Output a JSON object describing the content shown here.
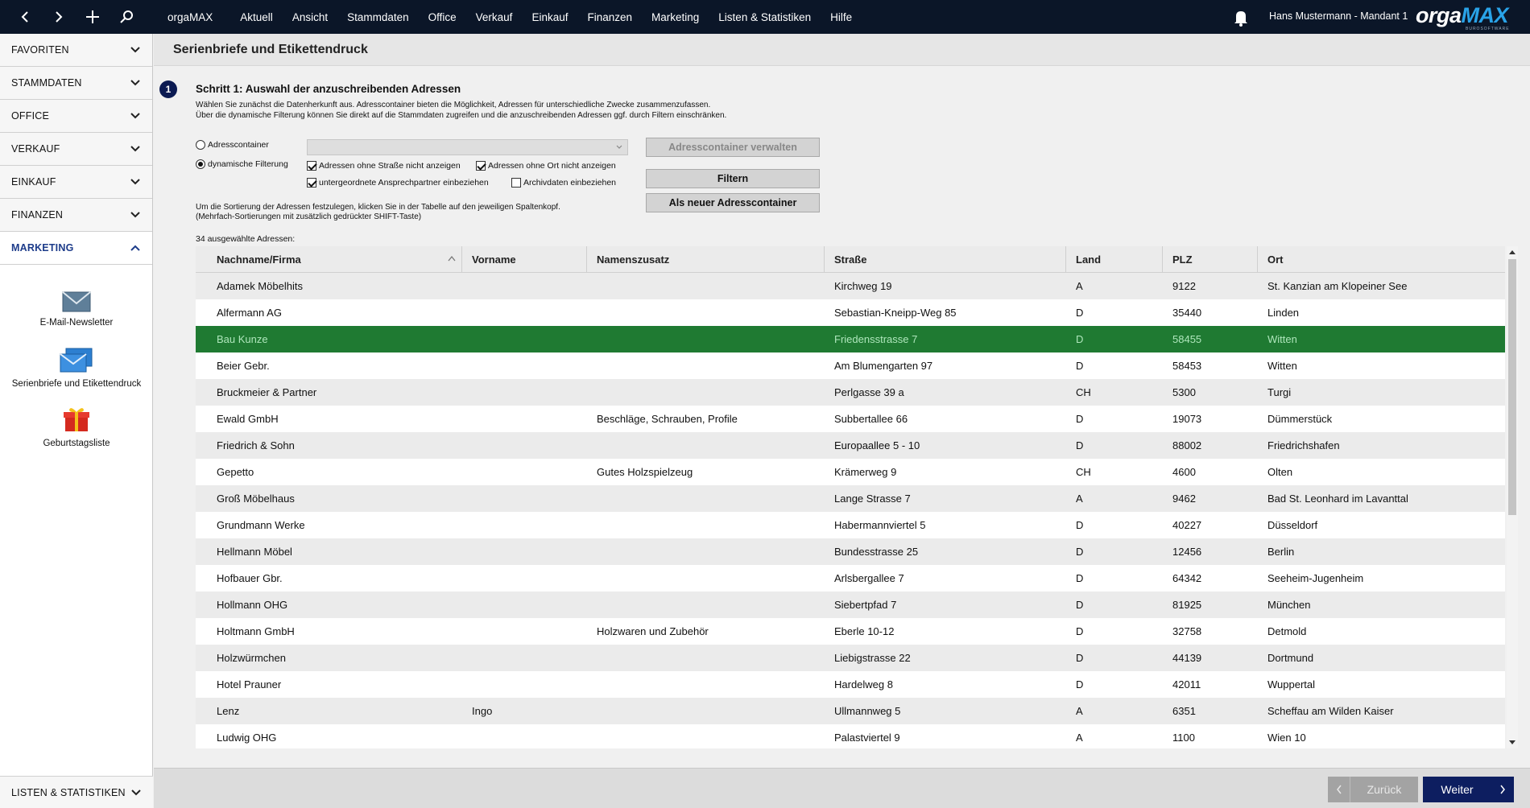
{
  "app": {
    "menu": [
      "orgaMAX",
      "Aktuell",
      "Ansicht",
      "Stammdaten",
      "Office",
      "Verkauf",
      "Einkauf",
      "Finanzen",
      "Marketing",
      "Listen & Statistiken",
      "Hilfe"
    ],
    "user": "Hans Mustermann - Mandant 1",
    "logo_main": "orga",
    "logo_accent": "MAX",
    "logo_sub": "BUROSOFTWARE"
  },
  "sidebar": {
    "sections": [
      {
        "label": "FAVORITEN"
      },
      {
        "label": "STAMMDATEN"
      },
      {
        "label": "OFFICE"
      },
      {
        "label": "VERKAUF"
      },
      {
        "label": "EINKAUF"
      },
      {
        "label": "FINANZEN"
      },
      {
        "label": "MARKETING"
      }
    ],
    "apps": [
      {
        "label": "E-Mail-Newsletter",
        "icon": "envelope-icon"
      },
      {
        "label": "Serienbriefe und Etikettendruck",
        "icon": "letters-icon"
      },
      {
        "label": "Geburtstagsliste",
        "icon": "gift-icon"
      }
    ],
    "bottom": "LISTEN & STATISTIKEN"
  },
  "page": {
    "title": "Serienbriefe und Etikettendruck",
    "step_number": "1",
    "step_title": "Schritt 1: Auswahl der anzuschreibenden Adressen",
    "desc_line1": "Wählen Sie zunächst die Datenherkunft aus. Adresscontainer bieten die Möglichkeit, Adressen für unterschiedliche Zwecke zusammenzufassen.",
    "desc_line2": "Über die dynamische Filterung können Sie direkt auf die Stammdaten zugreifen und die anzuschreibenden Adressen ggf. durch Filtern einschränken.",
    "radio_container": "Adresscontainer",
    "radio_dynamic": "dynamische Filterung",
    "check_no_street": "Adressen ohne Straße nicht anzeigen",
    "check_no_city": "Adressen ohne Ort nicht anzeigen",
    "check_subcontacts": "untergeordnete Ansprechpartner einbeziehen",
    "check_archive": "Archivdaten einbeziehen",
    "btn_manage": "Adresscontainer verwalten",
    "btn_filter": "Filtern",
    "btn_new_container": "Als neuer Adresscontainer",
    "hint_line1": "Um die Sortierung der Adressen festzulegen, klicken Sie in der Tabelle auf den jeweiligen Spaltenkopf.",
    "hint_line2": "(Mehrfach-Sortierungen mit zusätzlich gedrückter SHIFT-Taste)",
    "count": "34 ausgewählte Adressen:"
  },
  "table": {
    "columns": [
      "Nachname/Firma",
      "Vorname",
      "Namenszusatz",
      "Straße",
      "Land",
      "PLZ",
      "Ort"
    ],
    "rows": [
      [
        "Adamek Möbelhits",
        "",
        "",
        "Kirchweg 19",
        "A",
        "9122",
        "St. Kanzian am Klopeiner See"
      ],
      [
        "Alfermann AG",
        "",
        "",
        "Sebastian-Kneipp-Weg 85",
        "D",
        "35440",
        "Linden"
      ],
      [
        "Bau Kunze",
        "",
        "",
        "Friedensstrasse 7",
        "D",
        "58455",
        "Witten"
      ],
      [
        "Beier Gebr.",
        "",
        "",
        "Am Blumengarten 97",
        "D",
        "58453",
        "Witten"
      ],
      [
        "Bruckmeier & Partner",
        "",
        "",
        "Perlgasse 39 a",
        "CH",
        "5300",
        "Turgi"
      ],
      [
        "Ewald GmbH",
        "",
        "Beschläge, Schrauben, Profile",
        "Subbertallee 66",
        "D",
        "19073",
        "Dümmerstück"
      ],
      [
        "Friedrich & Sohn",
        "",
        "",
        "Europaallee 5 - 10",
        "D",
        "88002",
        "Friedrichshafen"
      ],
      [
        "Gepetto",
        "",
        "Gutes Holzspielzeug",
        "Krämerweg 9",
        "CH",
        "4600",
        "Olten"
      ],
      [
        "Groß Möbelhaus",
        "",
        "",
        "Lange Strasse 7",
        "A",
        "9462",
        "Bad St. Leonhard im Lavanttal"
      ],
      [
        "Grundmann Werke",
        "",
        "",
        "Habermannviertel 5",
        "D",
        "40227",
        "Düsseldorf"
      ],
      [
        "Hellmann Möbel",
        "",
        "",
        "Bundesstrasse 25",
        "D",
        "12456",
        "Berlin"
      ],
      [
        "Hofbauer Gbr.",
        "",
        "",
        "Arlsbergallee 7",
        "D",
        "64342",
        "Seeheim-Jugenheim"
      ],
      [
        "Hollmann OHG",
        "",
        "",
        "Siebertpfad 7",
        "D",
        "81925",
        "München"
      ],
      [
        "Holtmann GmbH",
        "",
        "Holzwaren und Zubehör",
        "Eberle 10-12",
        "D",
        "32758",
        "Detmold"
      ],
      [
        "Holzwürmchen",
        "",
        "",
        "Liebigstrasse 22",
        "D",
        "44139",
        "Dortmund"
      ],
      [
        "Hotel Prauner",
        "",
        "",
        "Hardelweg 8",
        "D",
        "42011",
        "Wuppertal"
      ],
      [
        "Lenz",
        "Ingo",
        "",
        "Ullmannweg 5",
        "A",
        "6351",
        "Scheffau am Wilden Kaiser"
      ],
      [
        "Ludwig OHG",
        "",
        "",
        "Palastviertel 9",
        "A",
        "1100",
        "Wien 10"
      ]
    ],
    "selected_row": 2
  },
  "footer": {
    "back": "Zurück",
    "next": "Weiter"
  },
  "colors": {
    "topbar": "#0b1628",
    "selected_row": "#1f7a32",
    "accent_blue": "#0d1e60"
  }
}
